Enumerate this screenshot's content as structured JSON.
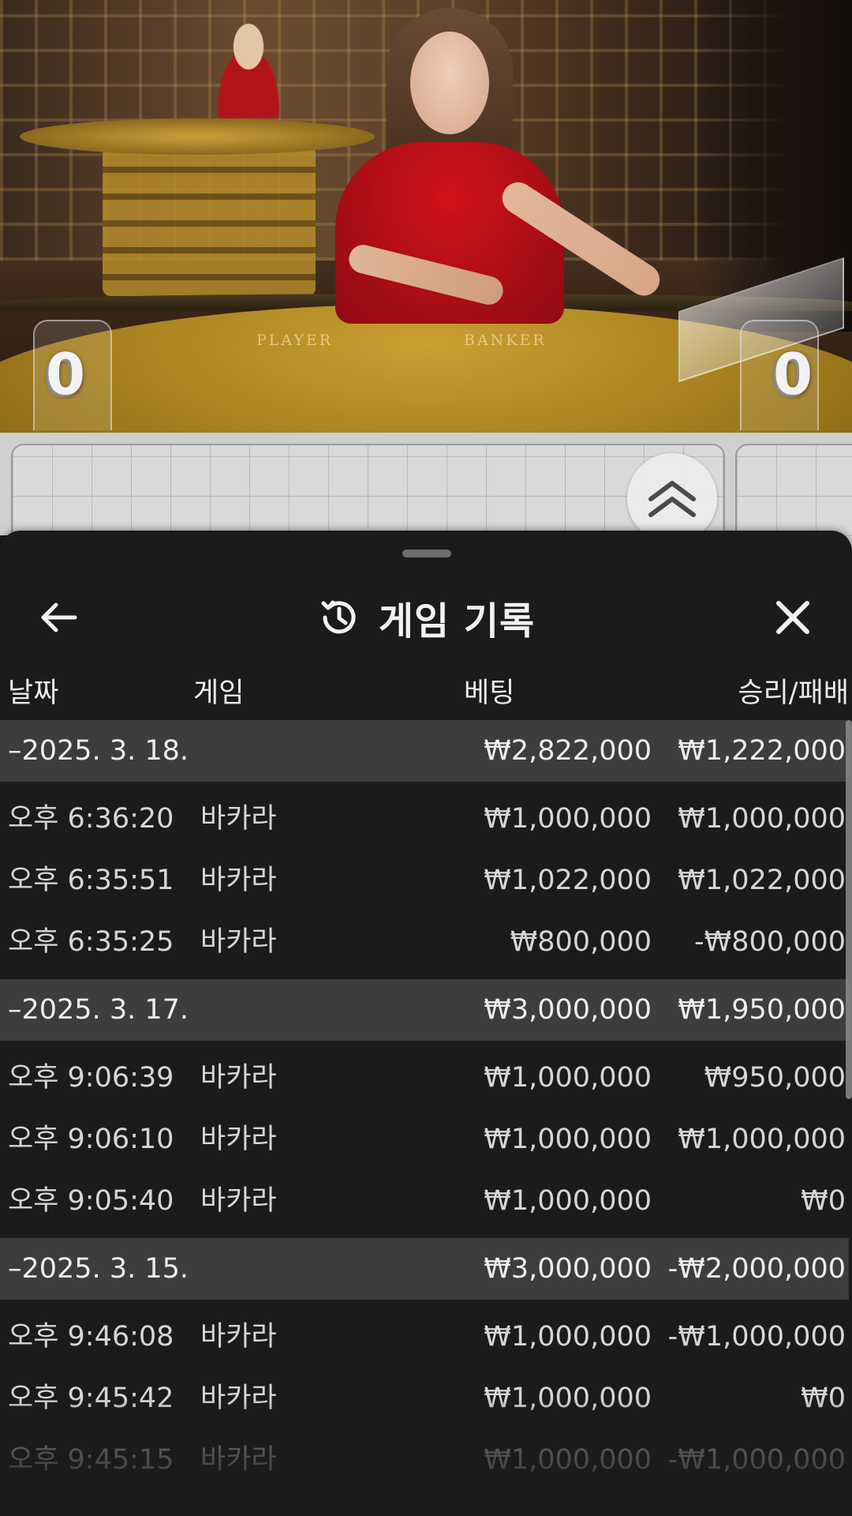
{
  "video": {
    "player_score": "0",
    "banker_score": "0",
    "felt_player_label": "PLAYER",
    "felt_banker_label": "BANKER"
  },
  "roadmap": {
    "expand_icon": "chevron-double-up-icon"
  },
  "sheet": {
    "title": "게임 기록",
    "back_icon": "arrow-left-icon",
    "history_icon": "history-icon",
    "close_icon": "close-icon",
    "columns": {
      "date": "날짜",
      "game": "게임",
      "bet": "베팅",
      "result": "승리/패배"
    },
    "groups": [
      {
        "date": "–2025. 3. 18.",
        "bet_total": "₩2,822,000",
        "result_total": "₩1,222,000",
        "rows": [
          {
            "time": "오후 6:36:20",
            "game": "바카라",
            "bet": "₩1,000,000",
            "result": "₩1,000,000"
          },
          {
            "time": "오후 6:35:51",
            "game": "바카라",
            "bet": "₩1,022,000",
            "result": "₩1,022,000"
          },
          {
            "time": "오후 6:35:25",
            "game": "바카라",
            "bet": "₩800,000",
            "result": "-₩800,000"
          }
        ]
      },
      {
        "date": "–2025. 3. 17.",
        "bet_total": "₩3,000,000",
        "result_total": "₩1,950,000",
        "rows": [
          {
            "time": "오후 9:06:39",
            "game": "바카라",
            "bet": "₩1,000,000",
            "result": "₩950,000"
          },
          {
            "time": "오후 9:06:10",
            "game": "바카라",
            "bet": "₩1,000,000",
            "result": "₩1,000,000"
          },
          {
            "time": "오후 9:05:40",
            "game": "바카라",
            "bet": "₩1,000,000",
            "result": "₩0"
          }
        ]
      },
      {
        "date": "–2025. 3. 15.",
        "bet_total": "₩3,000,000",
        "result_total": "-₩2,000,000",
        "rows": [
          {
            "time": "오후 9:46:08",
            "game": "바카라",
            "bet": "₩1,000,000",
            "result": "-₩1,000,000"
          },
          {
            "time": "오후 9:45:42",
            "game": "바카라",
            "bet": "₩1,000,000",
            "result": "₩0"
          },
          {
            "time": "오후 9:45:15",
            "game": "바카라",
            "bet": "₩1,000,000",
            "result": "-₩1,000,000"
          }
        ]
      }
    ]
  }
}
